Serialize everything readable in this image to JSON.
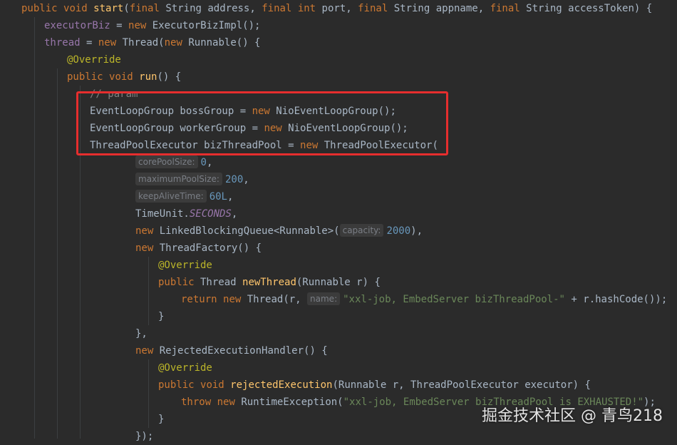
{
  "colors": {
    "background": "#2b2b2b",
    "keyword": "#cc7832",
    "method": "#ffc66d",
    "field": "#9876aa",
    "annotation": "#bbb529",
    "string": "#6a8759",
    "number": "#6897bb",
    "comment": "#808080",
    "default_text": "#a9b7c6",
    "highlight_box": "#e62e2e"
  },
  "code_lines": [
    {
      "indent": 1,
      "tokens": [
        {
          "t": "public",
          "c": "kw"
        },
        {
          "t": " "
        },
        {
          "t": "void",
          "c": "kw"
        },
        {
          "t": " "
        },
        {
          "t": "start",
          "c": "fn"
        },
        {
          "t": "("
        },
        {
          "t": "final",
          "c": "kw"
        },
        {
          "t": " String address, "
        },
        {
          "t": "final",
          "c": "kw"
        },
        {
          "t": " "
        },
        {
          "t": "int",
          "c": "kw"
        },
        {
          "t": " port, "
        },
        {
          "t": "final",
          "c": "kw"
        },
        {
          "t": " String appname, "
        },
        {
          "t": "final",
          "c": "kw"
        },
        {
          "t": " String accessToken) {"
        }
      ]
    },
    {
      "indent": 2,
      "tokens": [
        {
          "t": "executorBiz",
          "c": "field"
        },
        {
          "t": " = "
        },
        {
          "t": "new",
          "c": "kw"
        },
        {
          "t": " ExecutorBizImpl();"
        }
      ]
    },
    {
      "indent": 2,
      "tokens": [
        {
          "t": "thread",
          "c": "field"
        },
        {
          "t": " = "
        },
        {
          "t": "new",
          "c": "kw"
        },
        {
          "t": " Thread("
        },
        {
          "t": "new",
          "c": "kw"
        },
        {
          "t": " Runnable() {"
        }
      ]
    },
    {
      "indent": 3,
      "tokens": [
        {
          "t": "@Override",
          "c": "ann"
        }
      ]
    },
    {
      "indent": 3,
      "tokens": [
        {
          "t": "public",
          "c": "kw"
        },
        {
          "t": " "
        },
        {
          "t": "void",
          "c": "kw"
        },
        {
          "t": " "
        },
        {
          "t": "run",
          "c": "fn"
        },
        {
          "t": "() {"
        }
      ]
    },
    {
      "indent": 4,
      "tokens": [
        {
          "t": "// param",
          "c": "com"
        }
      ]
    },
    {
      "indent": 4,
      "tokens": [
        {
          "t": "EventLoopGroup bossGroup = "
        },
        {
          "t": "new",
          "c": "kw"
        },
        {
          "t": " NioEventLoopGroup();"
        }
      ]
    },
    {
      "indent": 4,
      "tokens": [
        {
          "t": "EventLoopGroup workerGroup = "
        },
        {
          "t": "new",
          "c": "kw"
        },
        {
          "t": " NioEventLoopGroup();"
        }
      ]
    },
    {
      "indent": 4,
      "tokens": [
        {
          "t": "ThreadPoolExecutor bizThreadPool = "
        },
        {
          "t": "new",
          "c": "kw"
        },
        {
          "t": " ThreadPoolExecutor("
        }
      ]
    },
    {
      "indent": 6,
      "tokens": [
        {
          "t": "corePoolSize:",
          "c": "hint"
        },
        {
          "t": "0",
          "c": "num"
        },
        {
          "t": ","
        }
      ]
    },
    {
      "indent": 6,
      "tokens": [
        {
          "t": "maximumPoolSize:",
          "c": "hint"
        },
        {
          "t": "200",
          "c": "num"
        },
        {
          "t": ","
        }
      ]
    },
    {
      "indent": 6,
      "tokens": [
        {
          "t": "keepAliveTime:",
          "c": "hint"
        },
        {
          "t": "60L",
          "c": "num"
        },
        {
          "t": ","
        }
      ]
    },
    {
      "indent": 6,
      "tokens": [
        {
          "t": "TimeUnit."
        },
        {
          "t": "SECONDS",
          "c": "const"
        },
        {
          "t": ","
        }
      ]
    },
    {
      "indent": 6,
      "tokens": [
        {
          "t": "new",
          "c": "kw"
        },
        {
          "t": " LinkedBlockingQueue<Runnable>("
        },
        {
          "t": "capacity:",
          "c": "hint"
        },
        {
          "t": "2000",
          "c": "num"
        },
        {
          "t": "),"
        }
      ]
    },
    {
      "indent": 6,
      "tokens": [
        {
          "t": "new",
          "c": "kw"
        },
        {
          "t": " ThreadFactory() {"
        }
      ]
    },
    {
      "indent": 7,
      "tokens": [
        {
          "t": "@Override",
          "c": "ann"
        }
      ]
    },
    {
      "indent": 7,
      "tokens": [
        {
          "t": "public",
          "c": "kw"
        },
        {
          "t": " Thread "
        },
        {
          "t": "newThread",
          "c": "fn"
        },
        {
          "t": "(Runnable r) {"
        }
      ]
    },
    {
      "indent": 8,
      "tokens": [
        {
          "t": "return",
          "c": "kw"
        },
        {
          "t": " "
        },
        {
          "t": "new",
          "c": "kw"
        },
        {
          "t": " Thread(r, "
        },
        {
          "t": "name:",
          "c": "hint"
        },
        {
          "t": "\"xxl-job, EmbedServer bizThreadPool-\"",
          "c": "str"
        },
        {
          "t": " + r.hashCode());"
        }
      ]
    },
    {
      "indent": 7,
      "tokens": [
        {
          "t": "}"
        }
      ]
    },
    {
      "indent": 6,
      "tokens": [
        {
          "t": "},"
        }
      ]
    },
    {
      "indent": 6,
      "tokens": [
        {
          "t": "new",
          "c": "kw"
        },
        {
          "t": " RejectedExecutionHandler() {"
        }
      ]
    },
    {
      "indent": 7,
      "tokens": [
        {
          "t": "@Override",
          "c": "ann"
        }
      ]
    },
    {
      "indent": 7,
      "tokens": [
        {
          "t": "public",
          "c": "kw"
        },
        {
          "t": " "
        },
        {
          "t": "void",
          "c": "kw"
        },
        {
          "t": " "
        },
        {
          "t": "rejectedExecution",
          "c": "fn"
        },
        {
          "t": "(Runnable r, ThreadPoolExecutor executor) {"
        }
      ]
    },
    {
      "indent": 8,
      "tokens": [
        {
          "t": "throw",
          "c": "kw"
        },
        {
          "t": " "
        },
        {
          "t": "new",
          "c": "kw"
        },
        {
          "t": " RuntimeException("
        },
        {
          "t": "\"xxl-job, EmbedServer bizThreadPool is EXHAUSTED!\"",
          "c": "str"
        },
        {
          "t": ");"
        }
      ]
    },
    {
      "indent": 7,
      "tokens": [
        {
          "t": "}"
        }
      ]
    },
    {
      "indent": 6,
      "tokens": [
        {
          "t": "});"
        }
      ]
    }
  ],
  "watermark": "掘金技术社区 @ 青鸟218"
}
